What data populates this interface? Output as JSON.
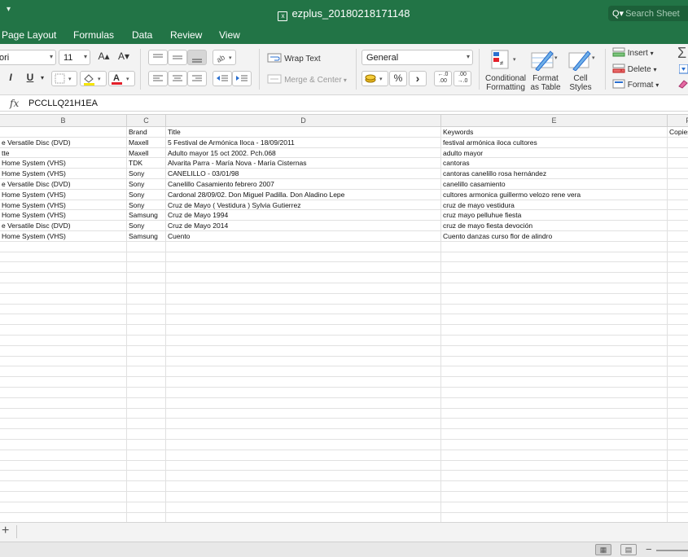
{
  "app": {
    "window_title": "ezplus_20180218171148",
    "search_placeholder": "Search Sheet",
    "qa_arrow": "▾"
  },
  "ribbon_tabs": [
    "Page Layout",
    "Formulas",
    "Data",
    "Review",
    "View"
  ],
  "ribbon": {
    "font_name": "ori",
    "font_size": "11",
    "grow_font": "A▴",
    "shrink_font": "A▾",
    "italic": "I",
    "underline": "U",
    "wrap_text": "Wrap Text",
    "merge_center": "Merge & Center",
    "number_format": "General",
    "percent": "%",
    "comma": "›",
    "inc_decimal": ".0\n.00",
    "dec_decimal": ".00\n.0",
    "conditional_formatting": [
      "Conditional",
      "Formatting"
    ],
    "format_as_table": [
      "Format",
      "as Table"
    ],
    "cell_styles": [
      "Cell",
      "Styles"
    ],
    "insert": "Insert",
    "delete": "Delete",
    "format": "Format",
    "sigma": "Σ"
  },
  "formula_bar": {
    "fx_label": "fx",
    "content": "PCCLLQ21H1EA"
  },
  "columns": [
    "B",
    "C",
    "D",
    "E",
    "F"
  ],
  "rows": [
    [
      "",
      "Brand",
      "Title",
      "Keywords",
      "Copies"
    ],
    [
      "e Versatile Disc (DVD)",
      "Maxell",
      "5 Festival de Armónica Iloca - 18/09/2011",
      "festival armónica iloca cultores",
      ""
    ],
    [
      "tte",
      "Maxell",
      "Adulto mayor 15 oct 2002. Pch.068",
      "adulto mayor",
      ""
    ],
    [
      "Home System (VHS)",
      "TDK",
      "Alvarita Parra - María Nova - María Cisternas",
      "cantoras",
      ""
    ],
    [
      "Home System (VHS)",
      "Sony",
      "CANELILLO - 03/01/98",
      "cantoras canelillo rosa hernández",
      ""
    ],
    [
      "e Versatile Disc (DVD)",
      "Sony",
      "Canelillo Casamiento febrero 2007",
      "canelillo casamiento",
      ""
    ],
    [
      "Home System (VHS)",
      "Sony",
      "Cardonal 28/09/02. Don Miguel Padilla. Don Aladino Lepe",
      "cultores armonica guillermo velozo rene vera",
      ""
    ],
    [
      "Home System (VHS)",
      "Sony",
      "Cruz de Mayo ( Vestidura ) Sylvia Gutierrez",
      "cruz de mayo vestidura",
      ""
    ],
    [
      "Home System (VHS)",
      "Samsung",
      "Cruz de Mayo 1994",
      "cruz mayo pelluhue fiesta",
      ""
    ],
    [
      "e Versatile Disc (DVD)",
      "Sony",
      "Cruz de Mayo 2014",
      "cruz de mayo fiesta devoción",
      ""
    ],
    [
      "Home System (VHS)",
      "Samsung",
      "Cuento",
      "Cuento danzas curso flor de alindro",
      ""
    ]
  ],
  "sheetbar": {
    "add_sheet": "+"
  },
  "statusbar": {
    "zoom_minus": "−"
  }
}
